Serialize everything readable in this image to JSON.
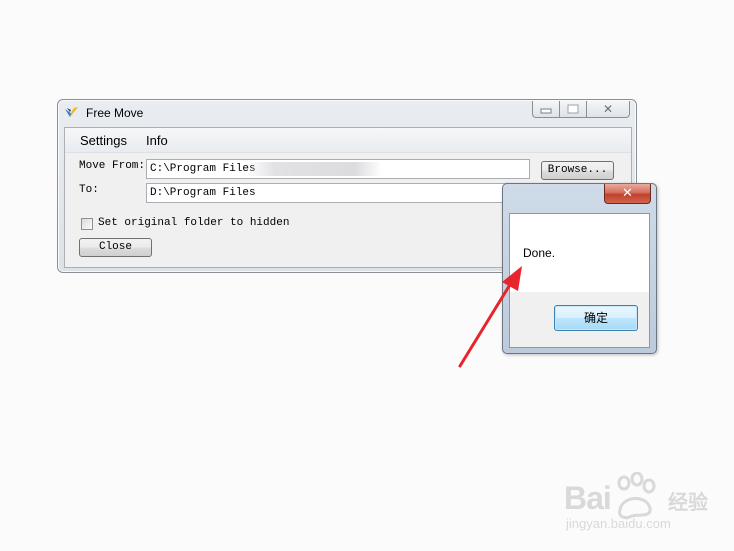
{
  "main_window": {
    "title": "Free Move",
    "menu": [
      "Settings",
      "Info"
    ],
    "move_from_label": "Move From:",
    "move_from_value": "C:\\Program Files",
    "to_label": "To:",
    "to_value": "D:\\Program Files",
    "browse_label": "Browse...",
    "checkbox_label": "Set original folder to hidden",
    "checkbox_checked": false,
    "close_label": "Close"
  },
  "dialog": {
    "message": "Done.",
    "ok_label": "确定"
  },
  "annotation": {
    "arrow_color": "#e8242c"
  },
  "watermark": {
    "brand_left": "Bai",
    "brand_right": "经验",
    "url": "jingyan.baidu.com"
  }
}
